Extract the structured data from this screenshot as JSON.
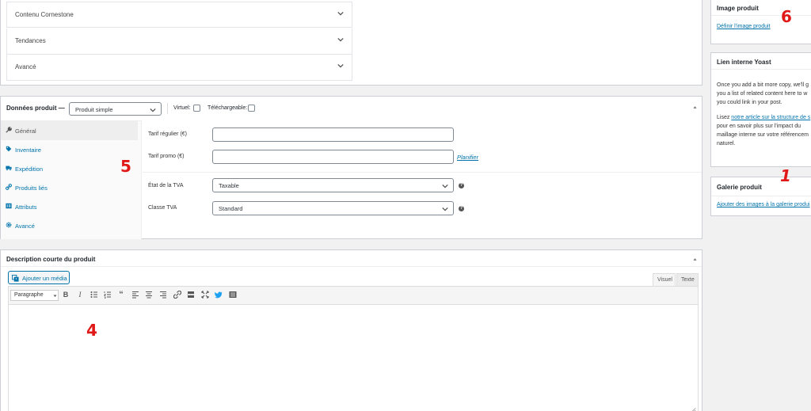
{
  "accordion": [
    {
      "label": "Contenu Cornestone"
    },
    {
      "label": "Tendances"
    },
    {
      "label": "Avancé"
    }
  ],
  "product_data": {
    "title": "Données produit —",
    "type_select": "Produit simple",
    "virtual_label": "Virtuel:",
    "downloadable_label": "Téléchargeable:",
    "tabs": [
      {
        "label": "Général"
      },
      {
        "label": "Inventaire"
      },
      {
        "label": "Expédition"
      },
      {
        "label": "Produits liés"
      },
      {
        "label": "Attributs"
      },
      {
        "label": "Avancé"
      }
    ],
    "regular_price_label": "Tarif régulier (€)",
    "sale_price_label": "Tarif promo (€)",
    "schedule_link": "Planifier",
    "tax_status_label": "État de la TVA",
    "tax_status_value": "Taxable",
    "tax_class_label": "Classe TVA",
    "tax_class_value": "Standard"
  },
  "short_description": {
    "title": "Description courte du produit",
    "add_media": "Ajouter un média",
    "tab_visual": "Visuel",
    "tab_text": "Texte",
    "format_select": "Paragraphe"
  },
  "sidebar": {
    "product_image": {
      "title": "Image produit",
      "link": "Définir l'image produit"
    },
    "yoast": {
      "title": "Lien interne Yoast",
      "text1": "Once you add a bit more copy, we'll g",
      "text2": "you a list of related content here to w",
      "text3": "you could link in your post.",
      "text4_pre": "Lisez ",
      "text4_link": "notre article sur la structure de s",
      "text5": "pour en savoir plus sur l'impact du",
      "text6": "maillage interne sur votre référencem",
      "text7": "naturel."
    },
    "gallery": {
      "title": "Galerie produit",
      "link": "Ajouter des images à la galerie produi"
    }
  },
  "annotations": {
    "n1": "1",
    "n4": "4",
    "n5": "5",
    "n6": "6"
  },
  "colors": {
    "accent": "#0073aa",
    "annotation": "#e01818",
    "background": "#f1f1f1"
  }
}
